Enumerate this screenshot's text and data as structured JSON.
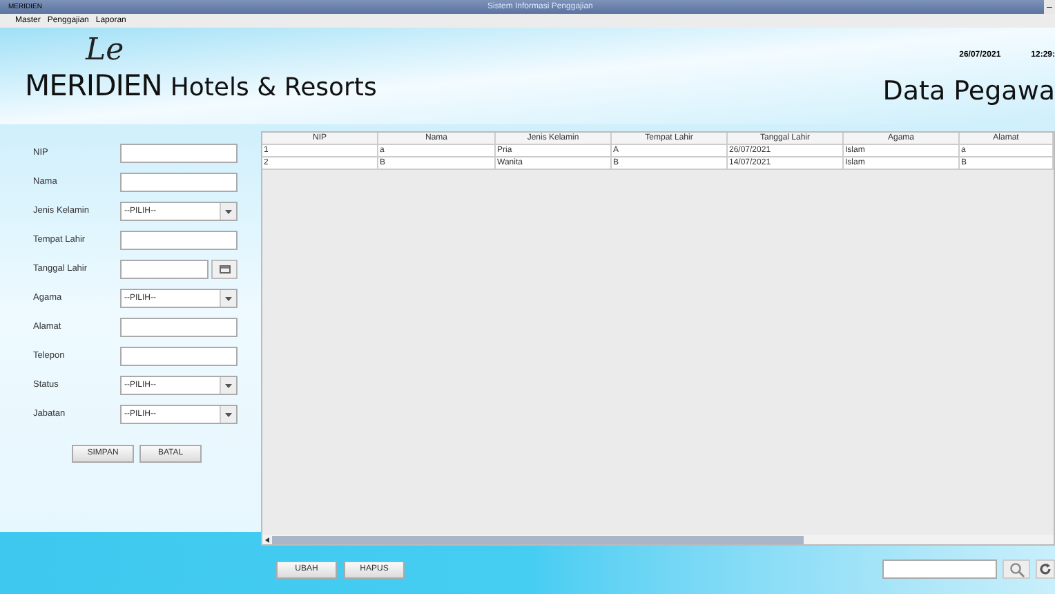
{
  "window": {
    "app_label": "MERIDIEN",
    "title": "Sistem Informasi Penggajian",
    "minimize": "–"
  },
  "menu": [
    "Master",
    "Penggajian",
    "Laporan"
  ],
  "header": {
    "logo_script": "Le",
    "logo_brand": "MERIDIEN",
    "logo_tagline": "Hotels & Resorts",
    "date": "26/07/2021",
    "time": "12:29:",
    "page_title": "Data Pegawa"
  },
  "form": {
    "fields": [
      {
        "label": "NIP",
        "kind": "text"
      },
      {
        "label": "Nama",
        "kind": "text"
      },
      {
        "label": "Jenis Kelamin",
        "kind": "select",
        "value": "--PILIH--"
      },
      {
        "label": "Tempat Lahir",
        "kind": "text"
      },
      {
        "label": "Tanggal Lahir",
        "kind": "date"
      },
      {
        "label": "Agama",
        "kind": "select",
        "value": "--PILIH--"
      },
      {
        "label": "Alamat",
        "kind": "text"
      },
      {
        "label": "Telepon",
        "kind": "text"
      },
      {
        "label": "Status",
        "kind": "select",
        "value": "--PILIH--"
      },
      {
        "label": "Jabatan",
        "kind": "select",
        "value": "--PILIH--"
      }
    ],
    "buttons": [
      "SIMPAN",
      "BATAL"
    ]
  },
  "table": {
    "columns": [
      "NIP",
      "Nama",
      "Jenis Kelamin",
      "Tempat Lahir",
      "Tanggal Lahir",
      "Agama",
      "Alamat"
    ],
    "rows": [
      [
        "1",
        "a",
        "Pria",
        "A",
        "26/07/2021",
        "Islam",
        "a"
      ],
      [
        "2",
        "B",
        "Wanita",
        "B",
        "14/07/2021",
        "Islam",
        "B"
      ]
    ]
  },
  "actions": [
    "UBAH",
    "HAPUS"
  ]
}
